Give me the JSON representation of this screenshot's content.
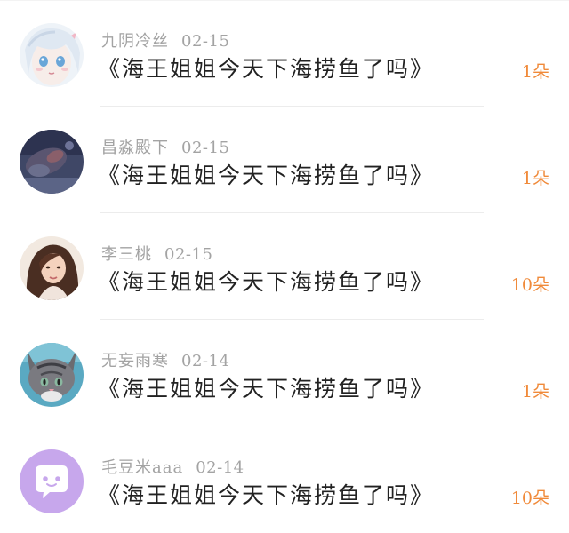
{
  "accent_color": "#f08a3a",
  "items": [
    {
      "username": "九阴冷丝",
      "date": "02-15",
      "title": "《海王姐姐今天下海捞鱼了吗》",
      "count": "1朵",
      "avatar_icon": "anime-girl-avatar"
    },
    {
      "username": "昌淼殿下",
      "date": "02-15",
      "title": "《海王姐姐今天下海捞鱼了吗》",
      "count": "1朵",
      "avatar_icon": "dark-photo-avatar"
    },
    {
      "username": "李三桃",
      "date": "02-15",
      "title": "《海王姐姐今天下海捞鱼了吗》",
      "count": "10朵",
      "avatar_icon": "woman-portrait-avatar"
    },
    {
      "username": "无妄雨寒",
      "date": "02-14",
      "title": "《海王姐姐今天下海捞鱼了吗》",
      "count": "1朵",
      "avatar_icon": "kitten-avatar"
    },
    {
      "username": "毛豆米aaa",
      "date": "02-14",
      "title": "《海王姐姐今天下海捞鱼了吗》",
      "count": "10朵",
      "avatar_icon": "default-chat-avatar"
    }
  ]
}
